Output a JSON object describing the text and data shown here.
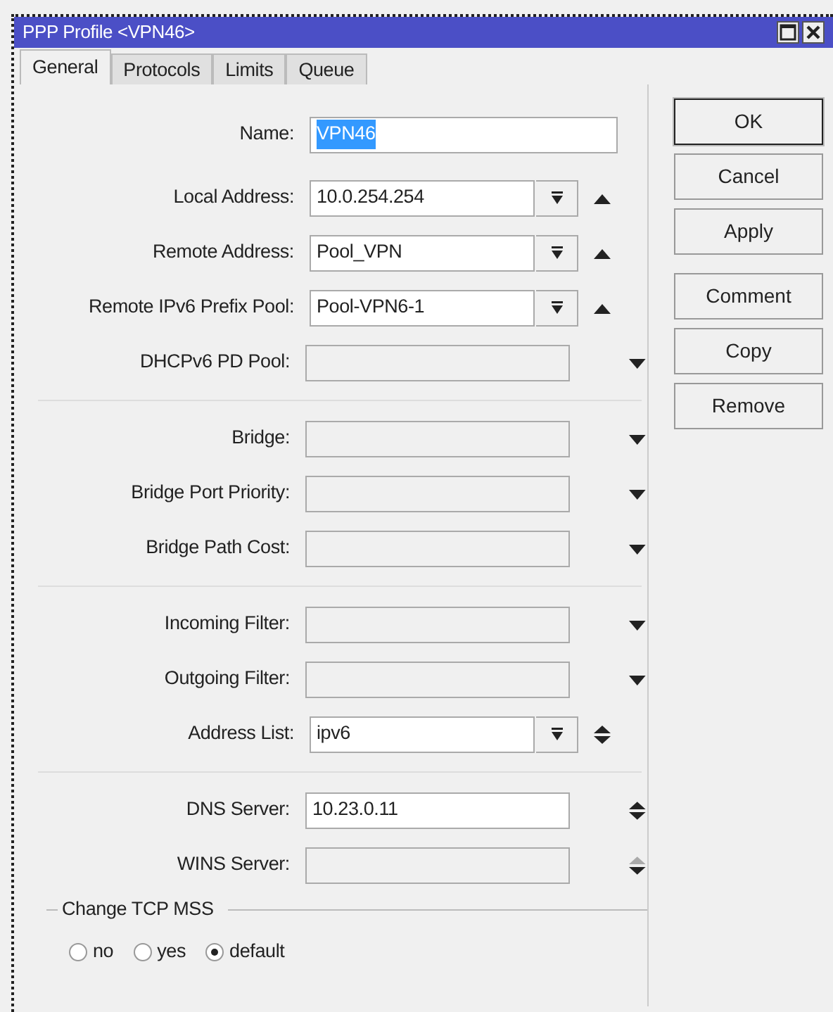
{
  "window": {
    "title": "PPP Profile <VPN46>"
  },
  "tabs": [
    {
      "label": "General",
      "selected": true
    },
    {
      "label": "Protocols",
      "selected": false
    },
    {
      "label": "Limits",
      "selected": false
    },
    {
      "label": "Queue",
      "selected": false
    }
  ],
  "sections": [
    {
      "fields": [
        {
          "label": "Name:",
          "value": "VPN46",
          "kind": "text",
          "value_selected": true,
          "enabled": true
        },
        {
          "label": "Local Address:",
          "value": "10.0.254.254",
          "kind": "combo",
          "up": true,
          "down": false,
          "enabled": true
        },
        {
          "label": "Remote Address:",
          "value": "Pool_VPN",
          "kind": "combo",
          "up": true,
          "down": false,
          "enabled": true
        },
        {
          "label": "Remote IPv6 Prefix Pool:",
          "value": "Pool-VPN6-1",
          "kind": "combo",
          "up": true,
          "down": false,
          "enabled": true
        },
        {
          "label": "DHCPv6 PD Pool:",
          "kind": "plain",
          "up": false,
          "down": true,
          "enabled": false
        }
      ]
    },
    {
      "fields": [
        {
          "label": "Bridge:",
          "kind": "plain",
          "up": false,
          "down": true,
          "enabled": false
        },
        {
          "label": "Bridge Port Priority:",
          "kind": "plain",
          "up": false,
          "down": true,
          "enabled": false
        },
        {
          "label": "Bridge Path Cost:",
          "kind": "plain",
          "up": false,
          "down": true,
          "enabled": false
        }
      ]
    },
    {
      "fields": [
        {
          "label": "Incoming Filter:",
          "kind": "plain",
          "up": false,
          "down": true,
          "enabled": false
        },
        {
          "label": "Outgoing Filter:",
          "kind": "plain",
          "up": false,
          "down": true,
          "enabled": false
        },
        {
          "label": "Address List:",
          "value": "ipv6",
          "kind": "combo",
          "up": true,
          "down": true,
          "enabled": true
        }
      ]
    },
    {
      "fields": [
        {
          "label": "DNS Server:",
          "value": "10.23.0.11",
          "kind": "plain",
          "up": true,
          "down": true,
          "enabled": true
        },
        {
          "label": "WINS Server:",
          "kind": "plain",
          "up": true,
          "down": true,
          "enabled": false
        }
      ]
    }
  ],
  "tcp_mss": {
    "title": "Change TCP MSS",
    "options": [
      {
        "label": "no",
        "selected": false
      },
      {
        "label": "yes",
        "selected": false
      },
      {
        "label": "default",
        "selected": true
      }
    ]
  },
  "button_groups": [
    [
      {
        "label": "OK",
        "default": true
      },
      {
        "label": "Cancel",
        "default": false
      },
      {
        "label": "Apply",
        "default": false
      }
    ],
    [
      {
        "label": "Comment",
        "default": false
      },
      {
        "label": "Copy",
        "default": false
      },
      {
        "label": "Remove",
        "default": false
      }
    ]
  ]
}
